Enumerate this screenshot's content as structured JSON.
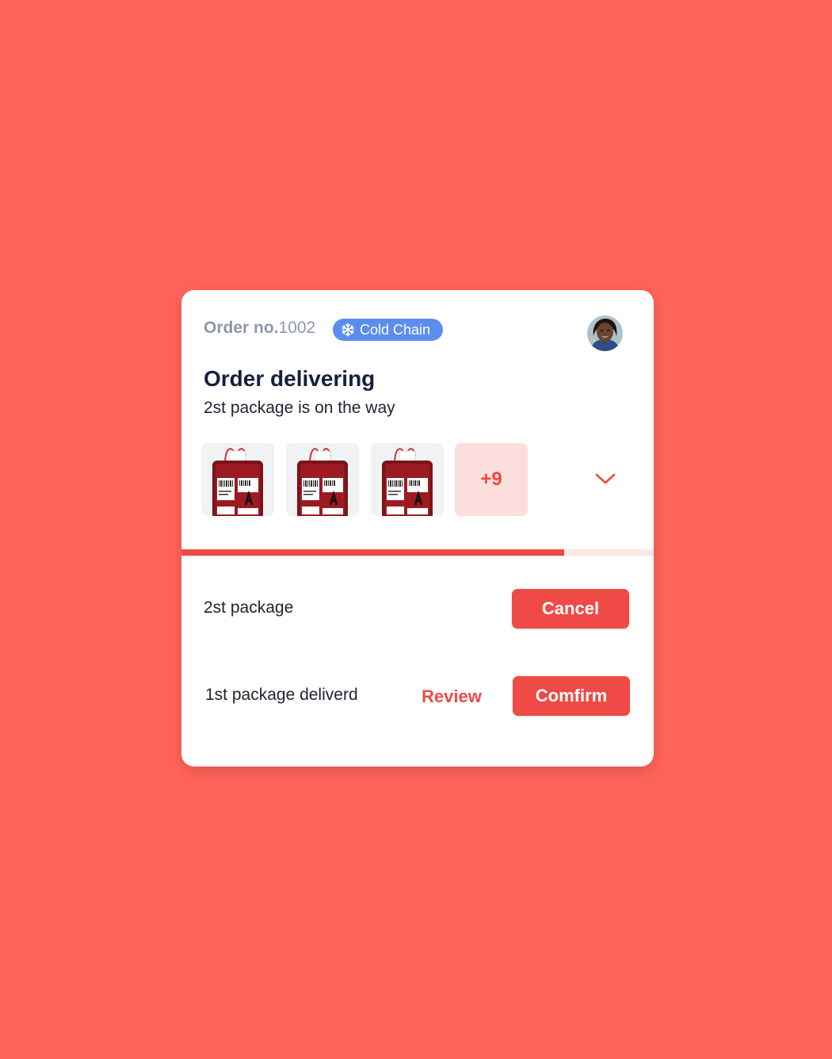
{
  "colors": {
    "background": "#FF645A",
    "accent": "#EF4A45",
    "badge": "#5B8DEF",
    "thumb_more_bg": "#FCDEDC"
  },
  "header": {
    "order_prefix": "Order no.",
    "order_number": "1002",
    "badge_icon": "snowflake-icon",
    "badge_label": "Cold Chain",
    "avatar": "user-avatar"
  },
  "status": {
    "title": "Order delivering",
    "subtitle": "2st package is on the way"
  },
  "thumbnails": {
    "items": [
      "blood-bag-image",
      "blood-bag-image",
      "blood-bag-image"
    ],
    "more_label": "+9",
    "expand_icon": "chevron-down-icon"
  },
  "progress": {
    "fraction": 0.81
  },
  "packages": [
    {
      "label": "2st package",
      "primary_action": "Cancel"
    },
    {
      "label": "1st package deliverd",
      "secondary_action": "Review",
      "primary_action": "Comfirm"
    }
  ]
}
